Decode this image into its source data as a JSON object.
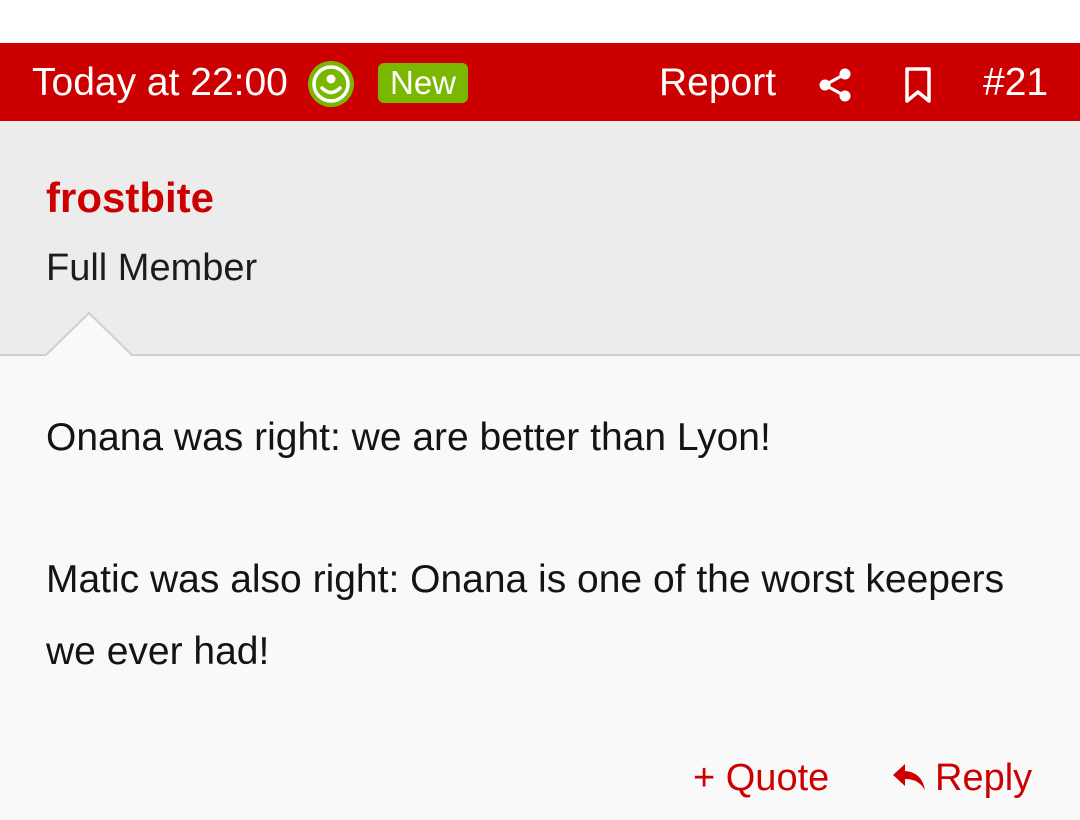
{
  "post": {
    "timestamp": "Today at 22:00",
    "online_icon": "smile-face-icon",
    "badge": "New",
    "report_label": "Report",
    "share_icon": "share-icon",
    "bookmark_icon": "bookmark-icon",
    "post_number": "#21"
  },
  "author": {
    "name": "frostbite",
    "title": "Full Member"
  },
  "message": {
    "paragraphs": [
      "Onana was right: we are better than Lyon!",
      "Matic was also right: Onana is one of the worst keepers we ever had!"
    ]
  },
  "actions": {
    "quote_label": "+ Quote",
    "reply_label": "Reply",
    "reply_icon": "reply-arrow-icon"
  },
  "colors": {
    "header_bg": "#cc0000",
    "badge_bg": "#7ab800",
    "online_icon": "#7ab800",
    "accent_text": "#cc0000",
    "user_bg": "#ececec",
    "body_bg": "#f9f9f9"
  }
}
